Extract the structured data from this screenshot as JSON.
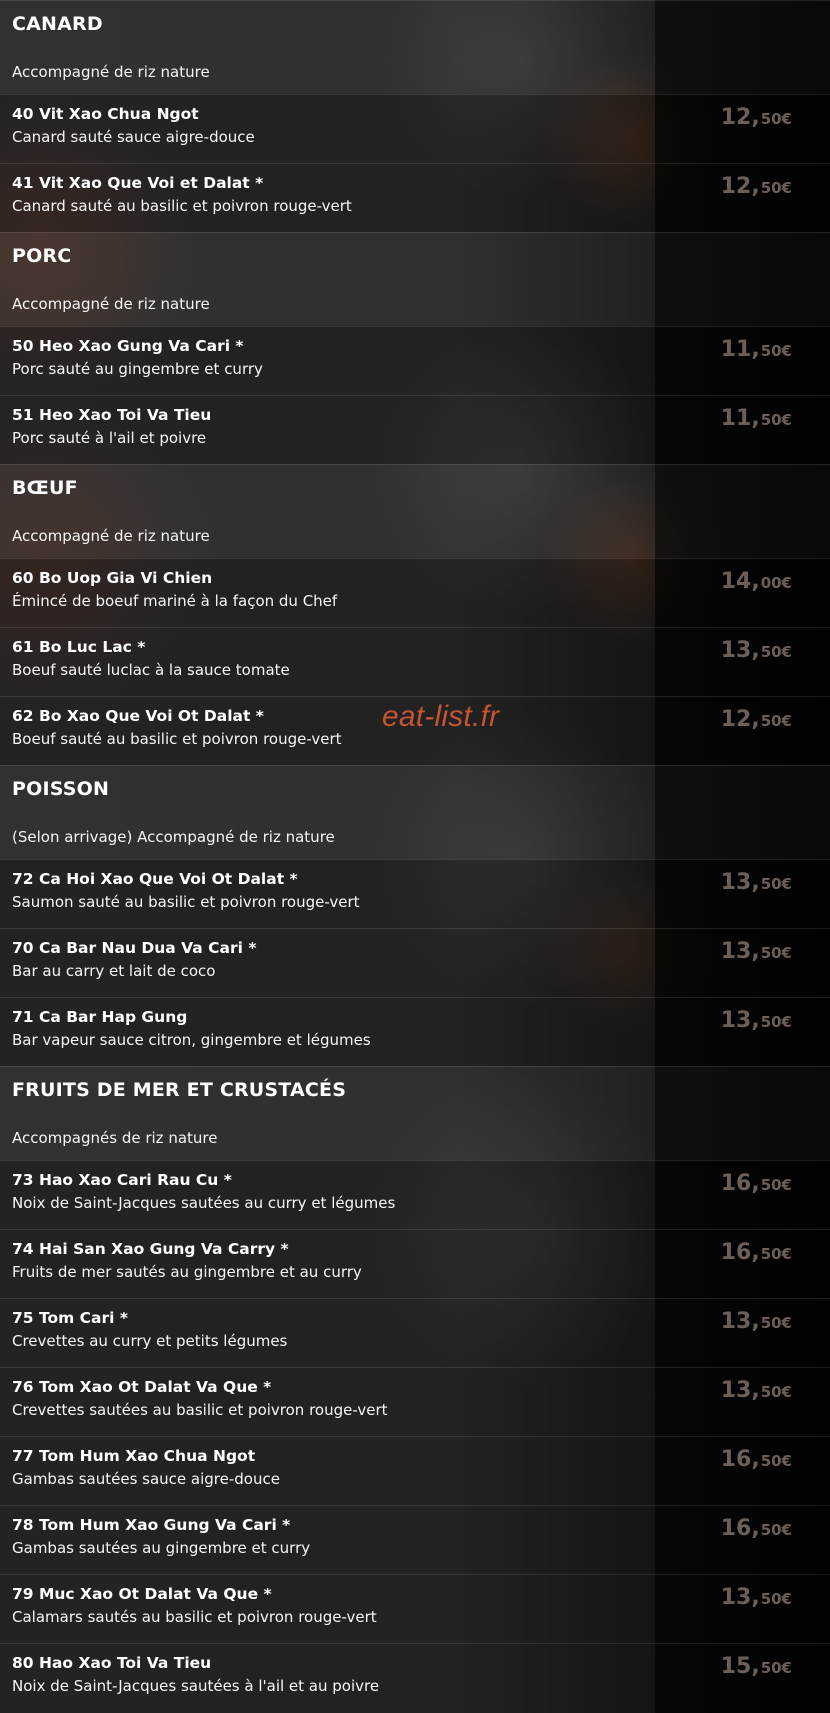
{
  "watermark": "eat-list.fr",
  "colors": {
    "text": "#ffffff",
    "price": "#6b5f58",
    "watermark": "#e15f37"
  },
  "sections": [
    {
      "title": "CANARD",
      "note": "Accompagné de riz nature",
      "items": [
        {
          "name": "40 Vit Xao Chua Ngot",
          "desc": "Canard sauté sauce aigre-douce",
          "price_int": "12,",
          "price_dec": "50€"
        },
        {
          "name": "41 Vit Xao Que Voi et Dalat *",
          "desc": "Canard sauté au basilic et poivron rouge-vert",
          "price_int": "12,",
          "price_dec": "50€"
        }
      ]
    },
    {
      "title": "PORC",
      "note": "Accompagné de riz nature",
      "items": [
        {
          "name": "50 Heo Xao Gung Va Cari *",
          "desc": "Porc sauté au gingembre et curry",
          "price_int": "11,",
          "price_dec": "50€"
        },
        {
          "name": "51 Heo Xao Toi Va Tieu",
          "desc": "Porc sauté à l'ail et poivre",
          "price_int": "11,",
          "price_dec": "50€"
        }
      ]
    },
    {
      "title": "BŒUF",
      "note": "Accompagné de riz nature",
      "items": [
        {
          "name": "60 Bo Uop Gia Vi Chien",
          "desc": "Émincé de boeuf mariné à la façon du Chef",
          "price_int": "14,",
          "price_dec": "00€"
        },
        {
          "name": "61 Bo Luc Lac *",
          "desc": "Boeuf sauté luclac à la sauce tomate",
          "price_int": "13,",
          "price_dec": "50€"
        },
        {
          "name": "62 Bo Xao Que Voi Ot Dalat *",
          "desc": "Boeuf sauté au basilic et poivron rouge-vert",
          "price_int": "12,",
          "price_dec": "50€"
        }
      ]
    },
    {
      "title": "POISSON",
      "note": "(Selon arrivage) Accompagné de riz nature",
      "items": [
        {
          "name": "72 Ca Hoi Xao Que Voi Ot Dalat *",
          "desc": "Saumon sauté au basilic et poivron rouge-vert",
          "price_int": "13,",
          "price_dec": "50€"
        },
        {
          "name": "70 Ca Bar Nau Dua Va Cari *",
          "desc": "Bar au carry et lait de coco",
          "price_int": "13,",
          "price_dec": "50€"
        },
        {
          "name": "71 Ca Bar Hap Gung",
          "desc": "Bar vapeur sauce citron, gingembre et légumes",
          "price_int": "13,",
          "price_dec": "50€"
        }
      ]
    },
    {
      "title": "FRUITS DE MER ET CRUSTACÉS",
      "note": "Accompagnés de riz nature",
      "items": [
        {
          "name": "73 Hao Xao Cari Rau Cu *",
          "desc": "Noix de Saint-Jacques sautées au curry et légumes",
          "price_int": "16,",
          "price_dec": "50€"
        },
        {
          "name": "74 Hai San Xao Gung Va Carry *",
          "desc": "Fruits de mer sautés au gingembre et au curry",
          "price_int": "16,",
          "price_dec": "50€"
        },
        {
          "name": "75 Tom Cari *",
          "desc": "Crevettes au curry et petits légumes",
          "price_int": "13,",
          "price_dec": "50€"
        },
        {
          "name": "76 Tom Xao Ot Dalat Va Que *",
          "desc": "Crevettes sautées au basilic et poivron rouge-vert",
          "price_int": "13,",
          "price_dec": "50€"
        },
        {
          "name": "77 Tom Hum Xao Chua Ngot",
          "desc": "Gambas sautées sauce aigre-douce",
          "price_int": "16,",
          "price_dec": "50€"
        },
        {
          "name": "78 Tom Hum Xao Gung Va Cari *",
          "desc": "Gambas sautées au gingembre et curry",
          "price_int": "16,",
          "price_dec": "50€"
        },
        {
          "name": "79 Muc Xao Ot Dalat Va Que *",
          "desc": "Calamars sautés au basilic et poivron rouge-vert",
          "price_int": "13,",
          "price_dec": "50€"
        },
        {
          "name": "80 Hao Xao Toi Va Tieu",
          "desc": "Noix de Saint-Jacques sautées à l'ail et au poivre",
          "price_int": "15,",
          "price_dec": "50€"
        }
      ]
    }
  ]
}
